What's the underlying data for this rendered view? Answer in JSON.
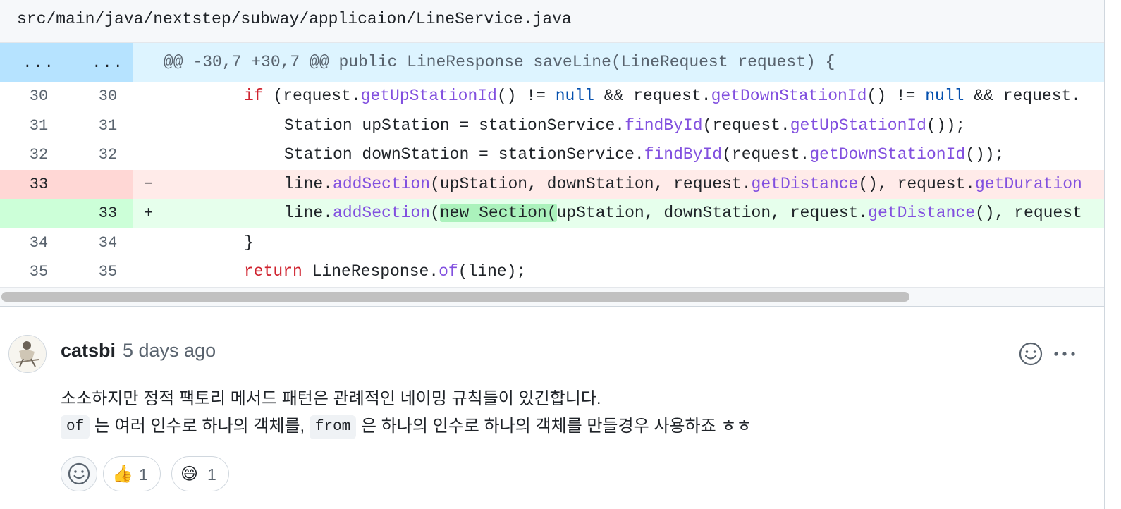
{
  "file": {
    "path": "src/main/java/nextstep/subway/applicaion/LineService.java"
  },
  "hunk": {
    "left": "...",
    "right": "...",
    "header": "@@ -30,7 +30,7 @@ public LineResponse saveLine(LineRequest request) {"
  },
  "lines": [
    {
      "old": "30",
      "new": "30",
      "type": "context"
    },
    {
      "old": "31",
      "new": "31",
      "type": "context"
    },
    {
      "old": "32",
      "new": "32",
      "type": "context"
    },
    {
      "old": "33",
      "new": "",
      "type": "deletion",
      "marker": "−"
    },
    {
      "old": "",
      "new": "33",
      "type": "addition",
      "marker": "+"
    },
    {
      "old": "34",
      "new": "34",
      "type": "context"
    },
    {
      "old": "35",
      "new": "35",
      "type": "context"
    }
  ],
  "code": {
    "l30": [
      "if",
      " (request.",
      "getUpStationId",
      "() != ",
      "null",
      " && request.",
      "getDownStationId",
      "() != ",
      "null",
      " && request."
    ],
    "l31": [
      "Station upStation = stationService.",
      "findById",
      "(request.",
      "getUpStationId",
      "());"
    ],
    "l32": [
      "Station downStation = stationService.",
      "findById",
      "(request.",
      "getDownStationId",
      "());"
    ],
    "l33del": [
      "line.",
      "addSection",
      "(upStation, downStation, request.",
      "getDistance",
      "(), request.",
      "getDuration"
    ],
    "l33add": [
      "line.",
      "addSection",
      "(",
      "new Section(",
      "upStation, downStation, request.",
      "getDistance",
      "(), request"
    ],
    "l34": [
      "}"
    ],
    "l35": [
      "return",
      " LineResponse.",
      "of",
      "(line);"
    ]
  },
  "comment": {
    "author": "catsbi",
    "time": "5 days ago",
    "line1": "소소하지만 정적 팩토리 메서드 패턴은 관례적인 네이밍 규칙들이 있긴합니다.",
    "line2": {
      "code1": "of",
      "text1": "는 여러 인수로 하나의 객체를,",
      "code2": "from",
      "text2": "은 하나의 인수로 하나의 객체를 만들경우 사용하죠 ㅎㅎ"
    },
    "more_icon": "···"
  },
  "reactions": [
    {
      "icon": "add-reaction-icon"
    },
    {
      "emoji": "👍",
      "count": "1"
    },
    {
      "emoji": "😄",
      "count": "1"
    }
  ],
  "colors": {
    "keyword": "#cf222e",
    "function": "#8250df",
    "constant": "#0550ae",
    "hunk_bg": "#ddf4ff",
    "deletion_bg": "#ffebe9",
    "addition_bg": "#e6ffec"
  }
}
